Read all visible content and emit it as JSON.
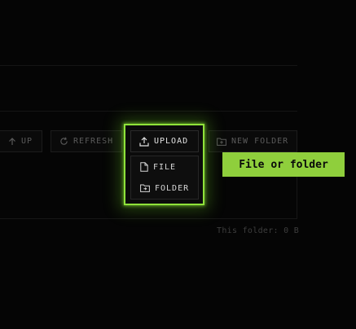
{
  "toolbar": {
    "up_label": "UP",
    "refresh_label": "REFRESH",
    "upload_label": "UPLOAD",
    "new_folder_label": "NEW FOLDER"
  },
  "upload_menu": {
    "items": [
      {
        "label": "FILE",
        "icon": "file-icon"
      },
      {
        "label": "FOLDER",
        "icon": "folder-upload-icon"
      }
    ]
  },
  "tooltip": {
    "text": "File or folder"
  },
  "status": {
    "folder_size": "This folder: 0 B"
  },
  "colors": {
    "accent": "#8fe23a",
    "tooltip_bg": "#8fcf3c",
    "background": "#050505"
  }
}
